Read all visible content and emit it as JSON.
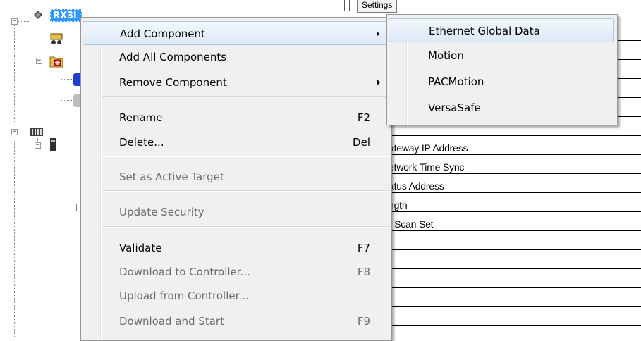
{
  "tree": {
    "root_label": "RX3i",
    "root_expander": "−",
    "node_expanders": [
      "−",
      "−",
      "−"
    ]
  },
  "grid": {
    "tab_label": "Settings",
    "rows": [
      "",
      "",
      "",
      "",
      "",
      "",
      "ateway IP Address",
      "etwork Time Sync",
      "atus Address",
      "ngth",
      ") Scan Set",
      "",
      "",
      "",
      "",
      ""
    ]
  },
  "menu": {
    "items": [
      {
        "label": "Add Component",
        "shortcut": "",
        "submenu": true,
        "disabled": false,
        "highlighted": true
      },
      {
        "label": "Add All Components",
        "shortcut": "",
        "submenu": false,
        "disabled": false
      },
      {
        "label": "Remove Component",
        "shortcut": "",
        "submenu": true,
        "disabled": false
      },
      {
        "label": "Rename",
        "shortcut": "F2",
        "disabled": false
      },
      {
        "label": "Delete...",
        "shortcut": "Del",
        "disabled": false
      },
      {
        "label": "Set as Active Target",
        "shortcut": "",
        "disabled": true
      },
      {
        "label": "Update Security",
        "shortcut": "",
        "disabled": true
      },
      {
        "label": "Validate",
        "shortcut": "F7",
        "disabled": false
      },
      {
        "label": "Download to Controller...",
        "shortcut": "F8",
        "disabled": true
      },
      {
        "label": "Upload from Controller...",
        "shortcut": "",
        "disabled": true
      },
      {
        "label": "Download and Start",
        "shortcut": "F9",
        "disabled": true
      }
    ]
  },
  "submenu": {
    "items": [
      {
        "label": "Ethernet Global Data",
        "highlighted": true
      },
      {
        "label": "Motion"
      },
      {
        "label": "PACMotion"
      },
      {
        "label": "VersaSafe"
      }
    ]
  },
  "colors": {
    "selection": "#3399ff",
    "menu_bg": "#f0f0f0",
    "highlight_border": "#a8c8ec",
    "disabled_text": "#6d6d6d"
  }
}
